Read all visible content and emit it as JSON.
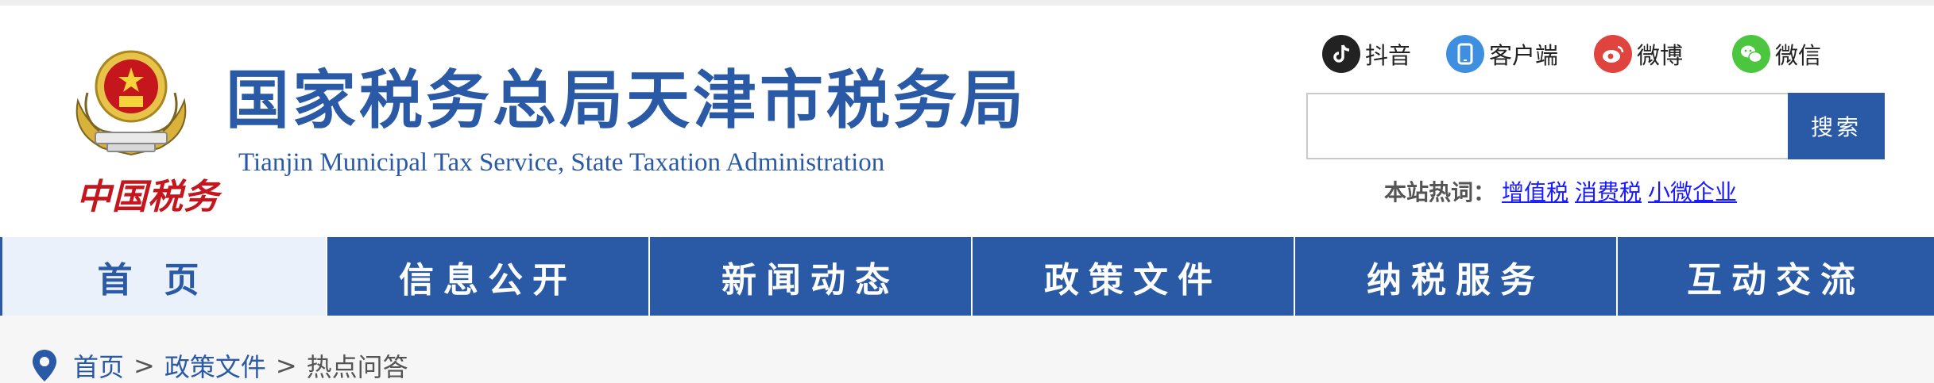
{
  "header": {
    "title": "国家税务总局天津市税务局",
    "subtitle": "Tianjin Municipal Tax Service, State Taxation Administration",
    "emblem_caption": "中国税务"
  },
  "social": [
    {
      "label": "抖音",
      "icon": "douyin-icon",
      "color": "#222222"
    },
    {
      "label": "客户端",
      "icon": "mobile-app-icon",
      "color": "#3f8fe0"
    },
    {
      "label": "微博",
      "icon": "weibo-icon",
      "color": "#e0443e"
    },
    {
      "label": "微信",
      "icon": "wechat-icon",
      "color": "#4cc63e"
    }
  ],
  "search": {
    "placeholder": "",
    "button_label": "搜索"
  },
  "hot": {
    "label": "本站热词：",
    "items": [
      "增值税",
      "消费税",
      "小微企业"
    ]
  },
  "nav": {
    "items": [
      "首页",
      "信息公开",
      "新闻动态",
      "政策文件",
      "纳税服务",
      "互动交流"
    ],
    "active_index": 0
  },
  "breadcrumb": {
    "items": [
      "首页",
      "政策文件",
      "热点问答"
    ],
    "separator": ">"
  },
  "colors": {
    "brand_blue": "#2a5aa6",
    "emblem_red": "#c4161c",
    "link_blue": "#1a1aff"
  }
}
